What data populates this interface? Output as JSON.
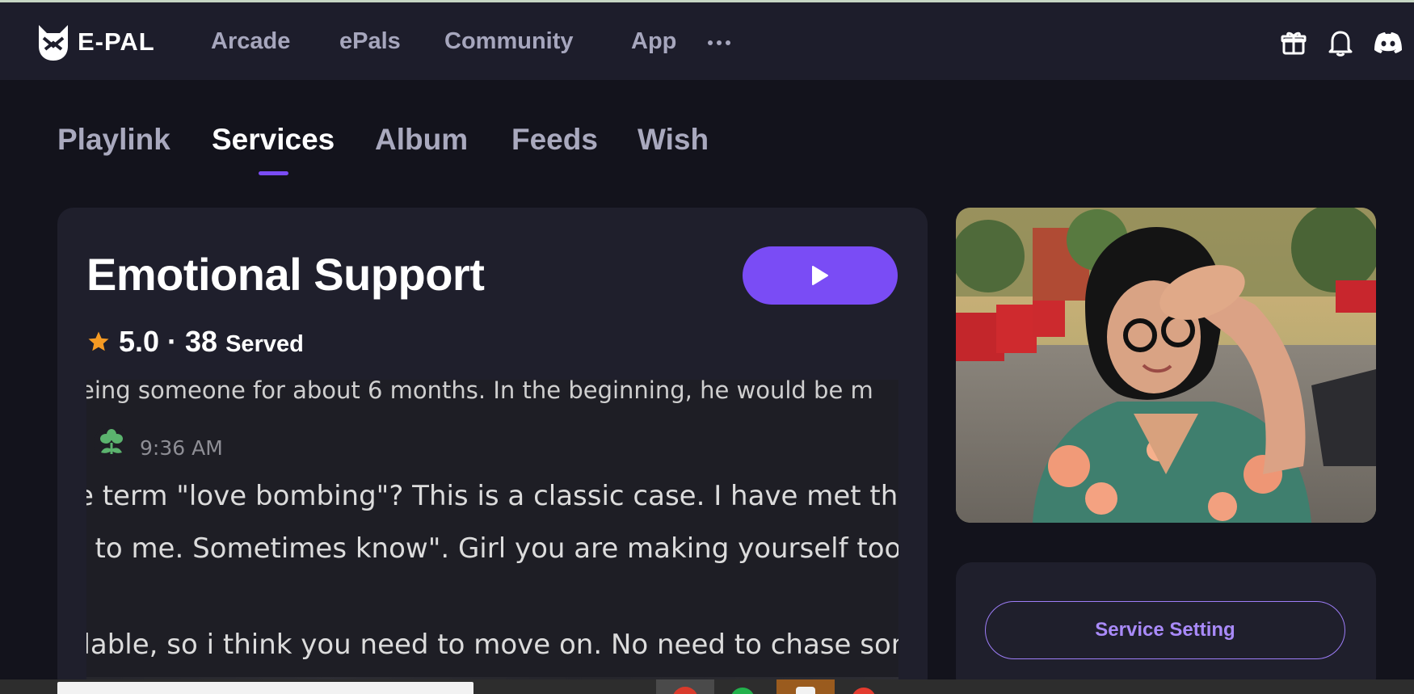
{
  "brand": {
    "name": "E-PAL",
    "accent": "#7a4cf5"
  },
  "nav": {
    "links": [
      {
        "label": "Arcade"
      },
      {
        "label": "ePals"
      },
      {
        "label": "Community"
      },
      {
        "label": "App"
      }
    ],
    "more_icon": "more-dots-icon",
    "right_icons": [
      "gift-icon",
      "bell-icon",
      "discord-icon"
    ]
  },
  "tabs": [
    {
      "label": "Playlink",
      "active": false
    },
    {
      "label": "Services",
      "active": true
    },
    {
      "label": "Album",
      "active": false
    },
    {
      "label": "Feeds",
      "active": false
    },
    {
      "label": "Wish",
      "active": false
    }
  ],
  "service": {
    "title": "Emotional Support",
    "rating": "5.0 · 38",
    "served_label": "Served",
    "play_icon": "play-icon",
    "star_color": "#f59a23"
  },
  "screenshot": {
    "cut_line": "eing someone for about 6 months. In the beginning, he would be m",
    "time": "9:36 AM",
    "line1": "e term \"love bombing\"? This is a classic case. I have met the",
    "line2": "k to me. Sometimes know\". Girl you are making yourself too",
    "line3": "ilable, so i think you need to move on. No need to chase son"
  },
  "sidebar": {
    "service_setting_label": "Service Setting"
  }
}
